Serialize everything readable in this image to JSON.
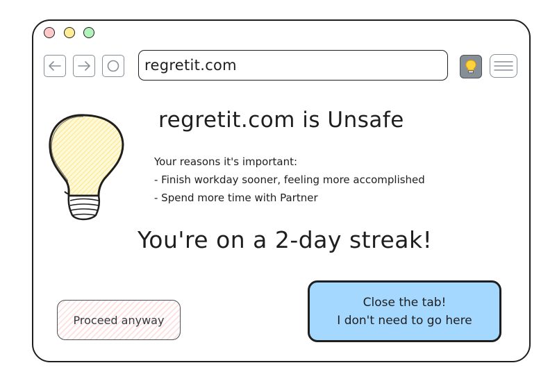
{
  "window": {
    "traffic_lights": [
      "close",
      "minimize",
      "maximize"
    ]
  },
  "toolbar": {
    "url": "regretit.com",
    "back_icon": "arrow-left-icon",
    "forward_icon": "arrow-right-icon",
    "reload_icon": "reload-icon",
    "extension_icon": "lightbulb-icon",
    "menu_icon": "hamburger-menu-icon"
  },
  "main": {
    "title": "regretit.com is Unsafe",
    "reasons_heading": "Your reasons it's important:",
    "reasons": [
      "- Finish workday sooner, feeling more accomplished",
      "- Spend more time with Partner"
    ],
    "streak": "You're on a 2-day streak!"
  },
  "actions": {
    "proceed_label": "Proceed anyway",
    "close_line1": "Close the tab!",
    "close_line2": "I don't need to go here"
  },
  "colors": {
    "close_button_bg": "#a5d8ff",
    "proceed_hatch": "#ffe3e3",
    "bulb_fill": "#fff3bf",
    "dot_red": "#ffc9c9",
    "dot_yellow": "#ffec99",
    "dot_green": "#b2f2bb"
  }
}
